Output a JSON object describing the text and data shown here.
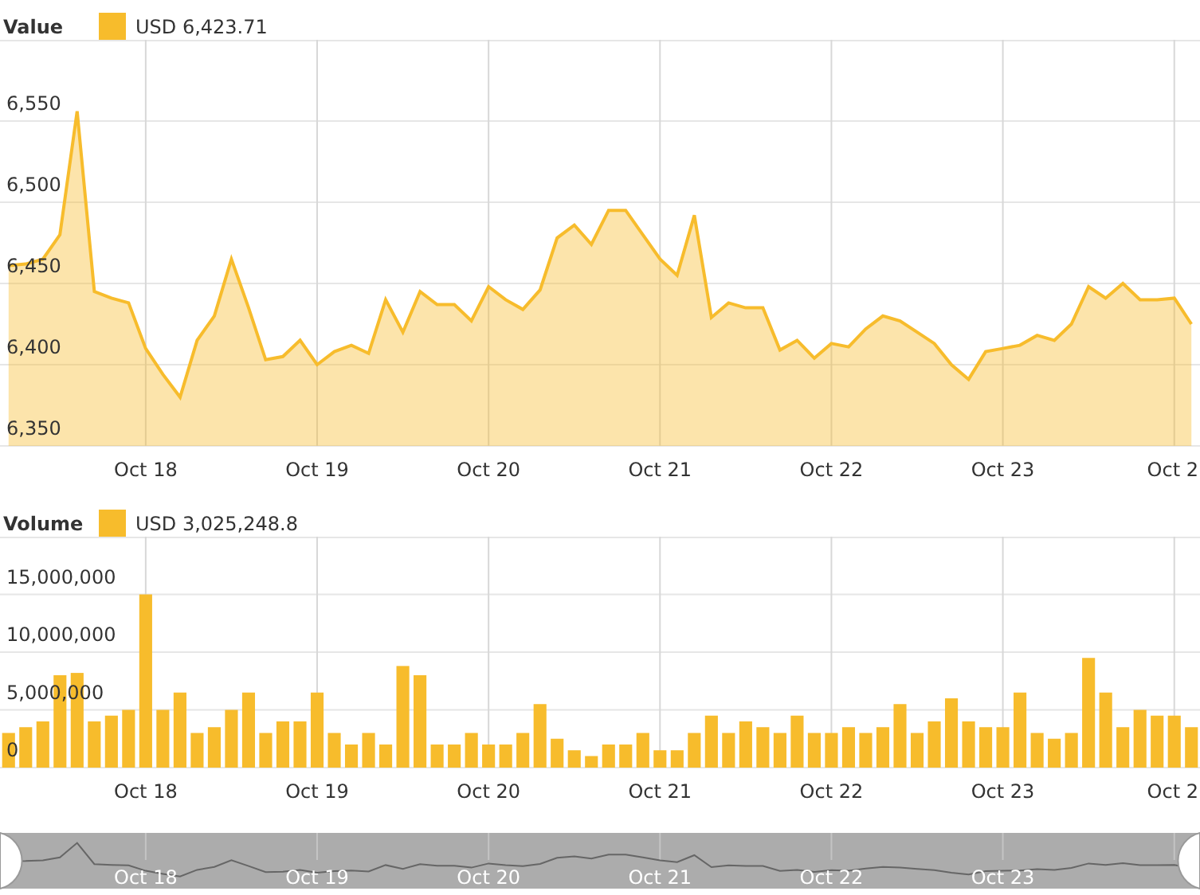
{
  "value_chart": {
    "legend": {
      "label": "USD 6,423.71"
    },
    "chart_data": {
      "type": "area",
      "grid": true,
      "categories": [
        null,
        null,
        null,
        null,
        null,
        null,
        null,
        null,
        "Oct 18",
        null,
        null,
        null,
        null,
        null,
        null,
        null,
        null,
        null,
        "Oct 19",
        null,
        null,
        null,
        null,
        null,
        null,
        null,
        null,
        null,
        "Oct 20",
        null,
        null,
        null,
        null,
        null,
        null,
        null,
        null,
        null,
        "Oct 21",
        null,
        null,
        null,
        null,
        null,
        null,
        null,
        null,
        null,
        "Oct 22",
        null,
        null,
        null,
        null,
        null,
        null,
        null,
        null,
        null,
        "Oct 23",
        null,
        null,
        null,
        null,
        null,
        null,
        null,
        null,
        null,
        "Oct 2",
        null
      ],
      "series": [
        {
          "name": "Value",
          "color": "#f7bc2c",
          "values": [
            6461,
            6462,
            6465,
            6480,
            6556,
            6445,
            6441,
            6438,
            6410,
            6394,
            6380,
            6415,
            6430,
            6465,
            6435,
            6403,
            6405,
            6415,
            6400,
            6408,
            6412,
            6407,
            6440,
            6420,
            6445,
            6437,
            6437,
            6427,
            6448,
            6440,
            6434,
            6446,
            6478,
            6486,
            6474,
            6495,
            6495,
            6480,
            6465,
            6455,
            6492,
            6429,
            6438,
            6435,
            6435,
            6409,
            6415,
            6404,
            6413,
            6411,
            6422,
            6430,
            6427,
            6420,
            6413,
            6400,
            6391,
            6408,
            6410,
            6412,
            6418,
            6415,
            6425,
            6448,
            6441,
            6450,
            6440,
            6440,
            6441,
            6425
          ]
        }
      ],
      "ylim": [
        6350,
        6600
      ],
      "yticks": [
        {
          "value": 6350,
          "label": "6,350"
        },
        {
          "value": 6400,
          "label": "6,400"
        },
        {
          "value": 6450,
          "label": "6,450"
        },
        {
          "value": 6500,
          "label": "6,500"
        },
        {
          "value": 6550,
          "label": "6,550"
        }
      ]
    }
  },
  "volume_chart": {
    "legend": {
      "label": "USD 3,025,248.8"
    },
    "chart_data": {
      "type": "bar",
      "grid": true,
      "categories": [
        null,
        null,
        null,
        null,
        null,
        null,
        null,
        null,
        "Oct 18",
        null,
        null,
        null,
        null,
        null,
        null,
        null,
        null,
        null,
        "Oct 19",
        null,
        null,
        null,
        null,
        null,
        null,
        null,
        null,
        null,
        "Oct 20",
        null,
        null,
        null,
        null,
        null,
        null,
        null,
        null,
        null,
        "Oct 21",
        null,
        null,
        null,
        null,
        null,
        null,
        null,
        null,
        null,
        "Oct 22",
        null,
        null,
        null,
        null,
        null,
        null,
        null,
        null,
        null,
        "Oct 23",
        null,
        null,
        null,
        null,
        null,
        null,
        null,
        null,
        null,
        "Oct 2",
        null
      ],
      "series": [
        {
          "name": "Volume",
          "color": "#f7bc2c",
          "values": [
            3000000,
            3500000,
            4000000,
            8000000,
            8200000,
            4000000,
            4500000,
            5000000,
            15000000,
            5000000,
            6500000,
            3000000,
            3500000,
            5000000,
            6500000,
            3000000,
            4000000,
            4000000,
            6500000,
            3000000,
            2000000,
            3000000,
            2000000,
            8800000,
            8000000,
            2000000,
            2000000,
            3000000,
            2000000,
            2000000,
            3000000,
            5500000,
            2500000,
            1500000,
            1000000,
            2000000,
            2000000,
            3000000,
            1500000,
            1500000,
            3000000,
            4500000,
            3000000,
            4000000,
            3500000,
            3000000,
            4500000,
            3000000,
            3000000,
            3500000,
            3000000,
            3500000,
            5500000,
            3000000,
            4000000,
            6000000,
            4000000,
            3500000,
            3500000,
            6500000,
            3000000,
            2500000,
            3000000,
            9500000,
            6500000,
            3500000,
            5000000,
            4500000,
            4500000,
            3500000
          ]
        }
      ],
      "ylim": [
        0,
        20000000
      ],
      "yticks": [
        {
          "value": 0,
          "label": "0"
        },
        {
          "value": 5000000,
          "label": "5,000,000"
        },
        {
          "value": 10000000,
          "label": "10,000,000"
        },
        {
          "value": 15000000,
          "label": "15,000,000"
        }
      ]
    }
  },
  "navigator": {
    "labels": [
      "Oct 18",
      "Oct 19",
      "Oct 20",
      "Oct 21",
      "Oct 22",
      "Oct 23"
    ]
  }
}
